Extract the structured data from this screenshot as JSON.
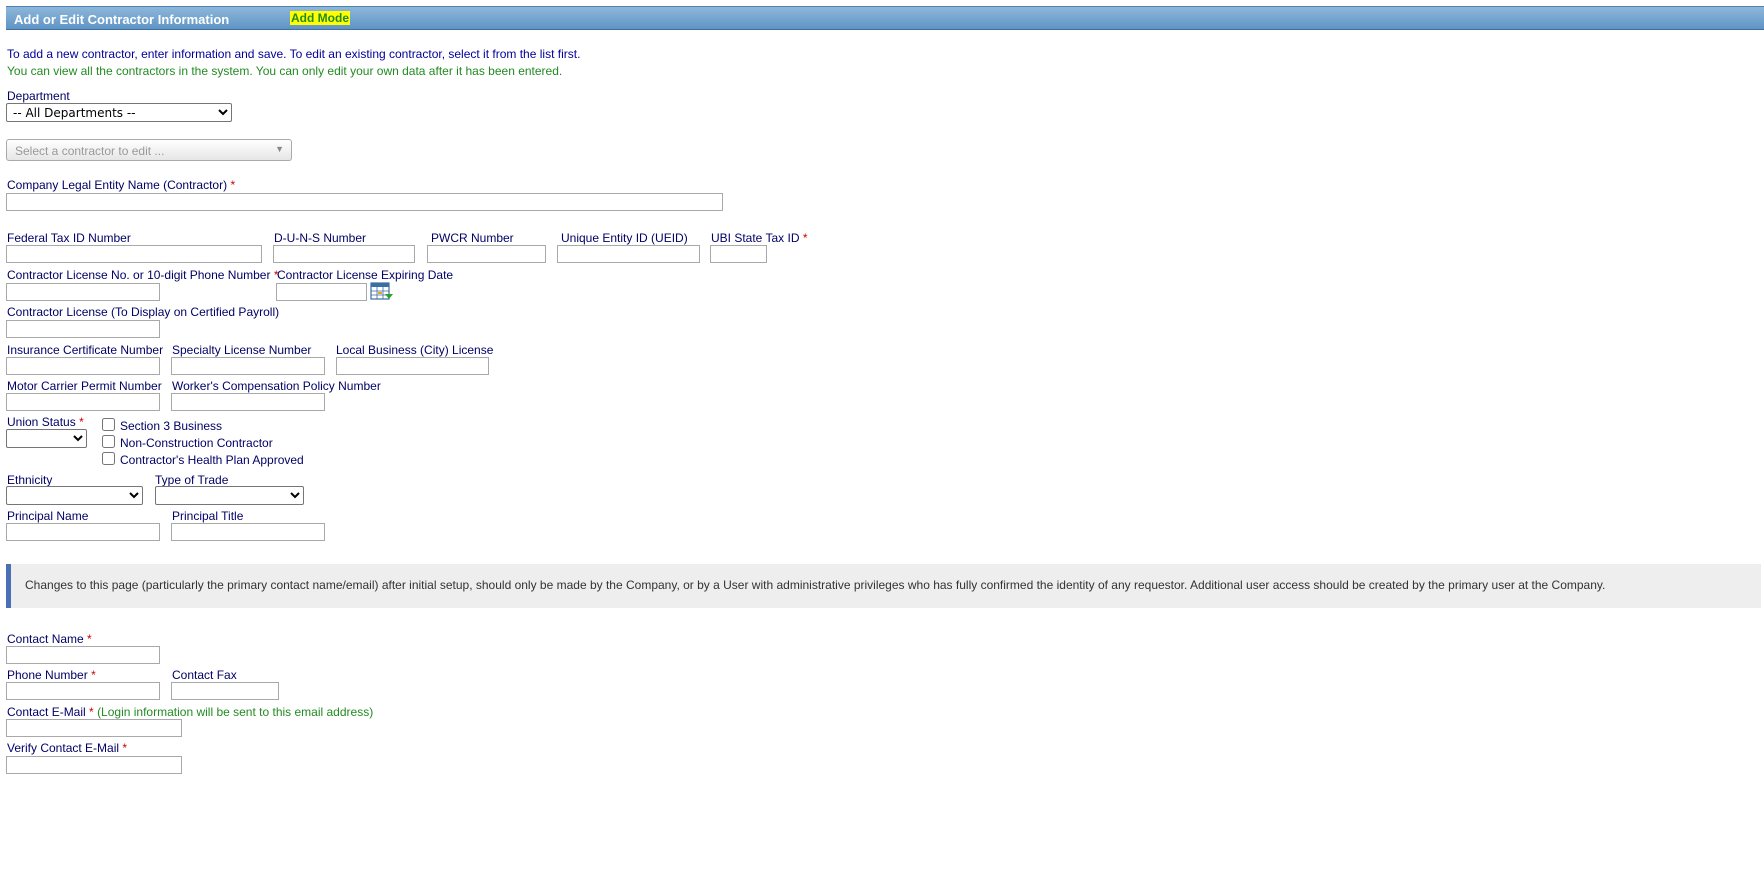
{
  "header": {
    "title": "Add or Edit Contractor Information",
    "mode": "Add Mode"
  },
  "intro": {
    "line1": "To add a new contractor, enter information and save. To edit an existing contractor, select it from the list first.",
    "line2": "You can view all the contractors in the system. You can only edit your own data after it has been entered."
  },
  "department": {
    "label": "Department",
    "selected": "-- All Departments --"
  },
  "contractor_picker": {
    "placeholder": "Select a contractor to edit ..."
  },
  "fields": {
    "company_name": {
      "label": "Company Legal Entity Name (Contractor)",
      "required": "*",
      "value": ""
    },
    "federal_tax_id": {
      "label": "Federal Tax ID Number",
      "value": ""
    },
    "duns": {
      "label": "D-U-N-S Number",
      "value": ""
    },
    "pwcr": {
      "label": "PWCR Number",
      "value": ""
    },
    "ueid": {
      "label": "Unique Entity ID (UEID)",
      "value": ""
    },
    "ubi": {
      "label": "UBI State Tax ID",
      "required": "*",
      "value": ""
    },
    "license_no": {
      "label": "Contractor License No. or 10-digit Phone Number",
      "required": "*",
      "value": ""
    },
    "license_expiry": {
      "label": "Contractor License Expiring Date",
      "value": ""
    },
    "license_display": {
      "label": "Contractor License (To Display on Certified Payroll)",
      "value": ""
    },
    "insurance_cert": {
      "label": "Insurance Certificate Number",
      "value": ""
    },
    "specialty_license": {
      "label": "Specialty License Number",
      "value": ""
    },
    "local_business": {
      "label": "Local Business (City) License",
      "value": ""
    },
    "motor_carrier": {
      "label": "Motor Carrier Permit Number",
      "value": ""
    },
    "workers_comp": {
      "label": "Worker's Compensation Policy Number",
      "value": ""
    },
    "union_status": {
      "label": "Union Status",
      "required": "*",
      "selected": ""
    },
    "ethnicity": {
      "label": "Ethnicity",
      "selected": ""
    },
    "type_of_trade": {
      "label": "Type of Trade",
      "selected": ""
    },
    "principal_name": {
      "label": "Principal Name",
      "value": ""
    },
    "principal_title": {
      "label": "Principal Title",
      "value": ""
    },
    "contact_name": {
      "label": "Contact Name",
      "required": "*",
      "value": ""
    },
    "phone_number": {
      "label": "Phone Number",
      "required": "*",
      "value": ""
    },
    "contact_fax": {
      "label": "Contact Fax",
      "value": ""
    },
    "contact_email": {
      "label": "Contact E-Mail",
      "required": "*",
      "note": "(Login information will be sent to this email address)",
      "value": ""
    },
    "verify_email": {
      "label": "Verify Contact E-Mail",
      "required": "*",
      "value": ""
    }
  },
  "checkboxes": [
    {
      "label": "Section 3 Business",
      "checked": false
    },
    {
      "label": "Non-Construction Contractor",
      "checked": false
    },
    {
      "label": "Contractor's Health Plan Approved",
      "checked": false
    }
  ],
  "notice": {
    "text": "Changes to this page (particularly the primary contact name/email) after initial setup, should only be made by the Company, or by a User with administrative privileges who has fully confirmed the identity of any requestor. Additional user access should be created by the primary user at the Company."
  },
  "icons": {
    "calendar": "calendar-icon",
    "dropdown": "chevron-down-icon"
  },
  "colors": {
    "header_gradient_top": "#8db7da",
    "header_gradient_bottom": "#5f94c5",
    "mode_badge_bg": "#ffff00",
    "mode_badge_text": "#228b22",
    "label_text": "#000066",
    "required_star": "#cc0000",
    "green_note": "#228b22",
    "notice_bar": "#4a6fb5"
  }
}
